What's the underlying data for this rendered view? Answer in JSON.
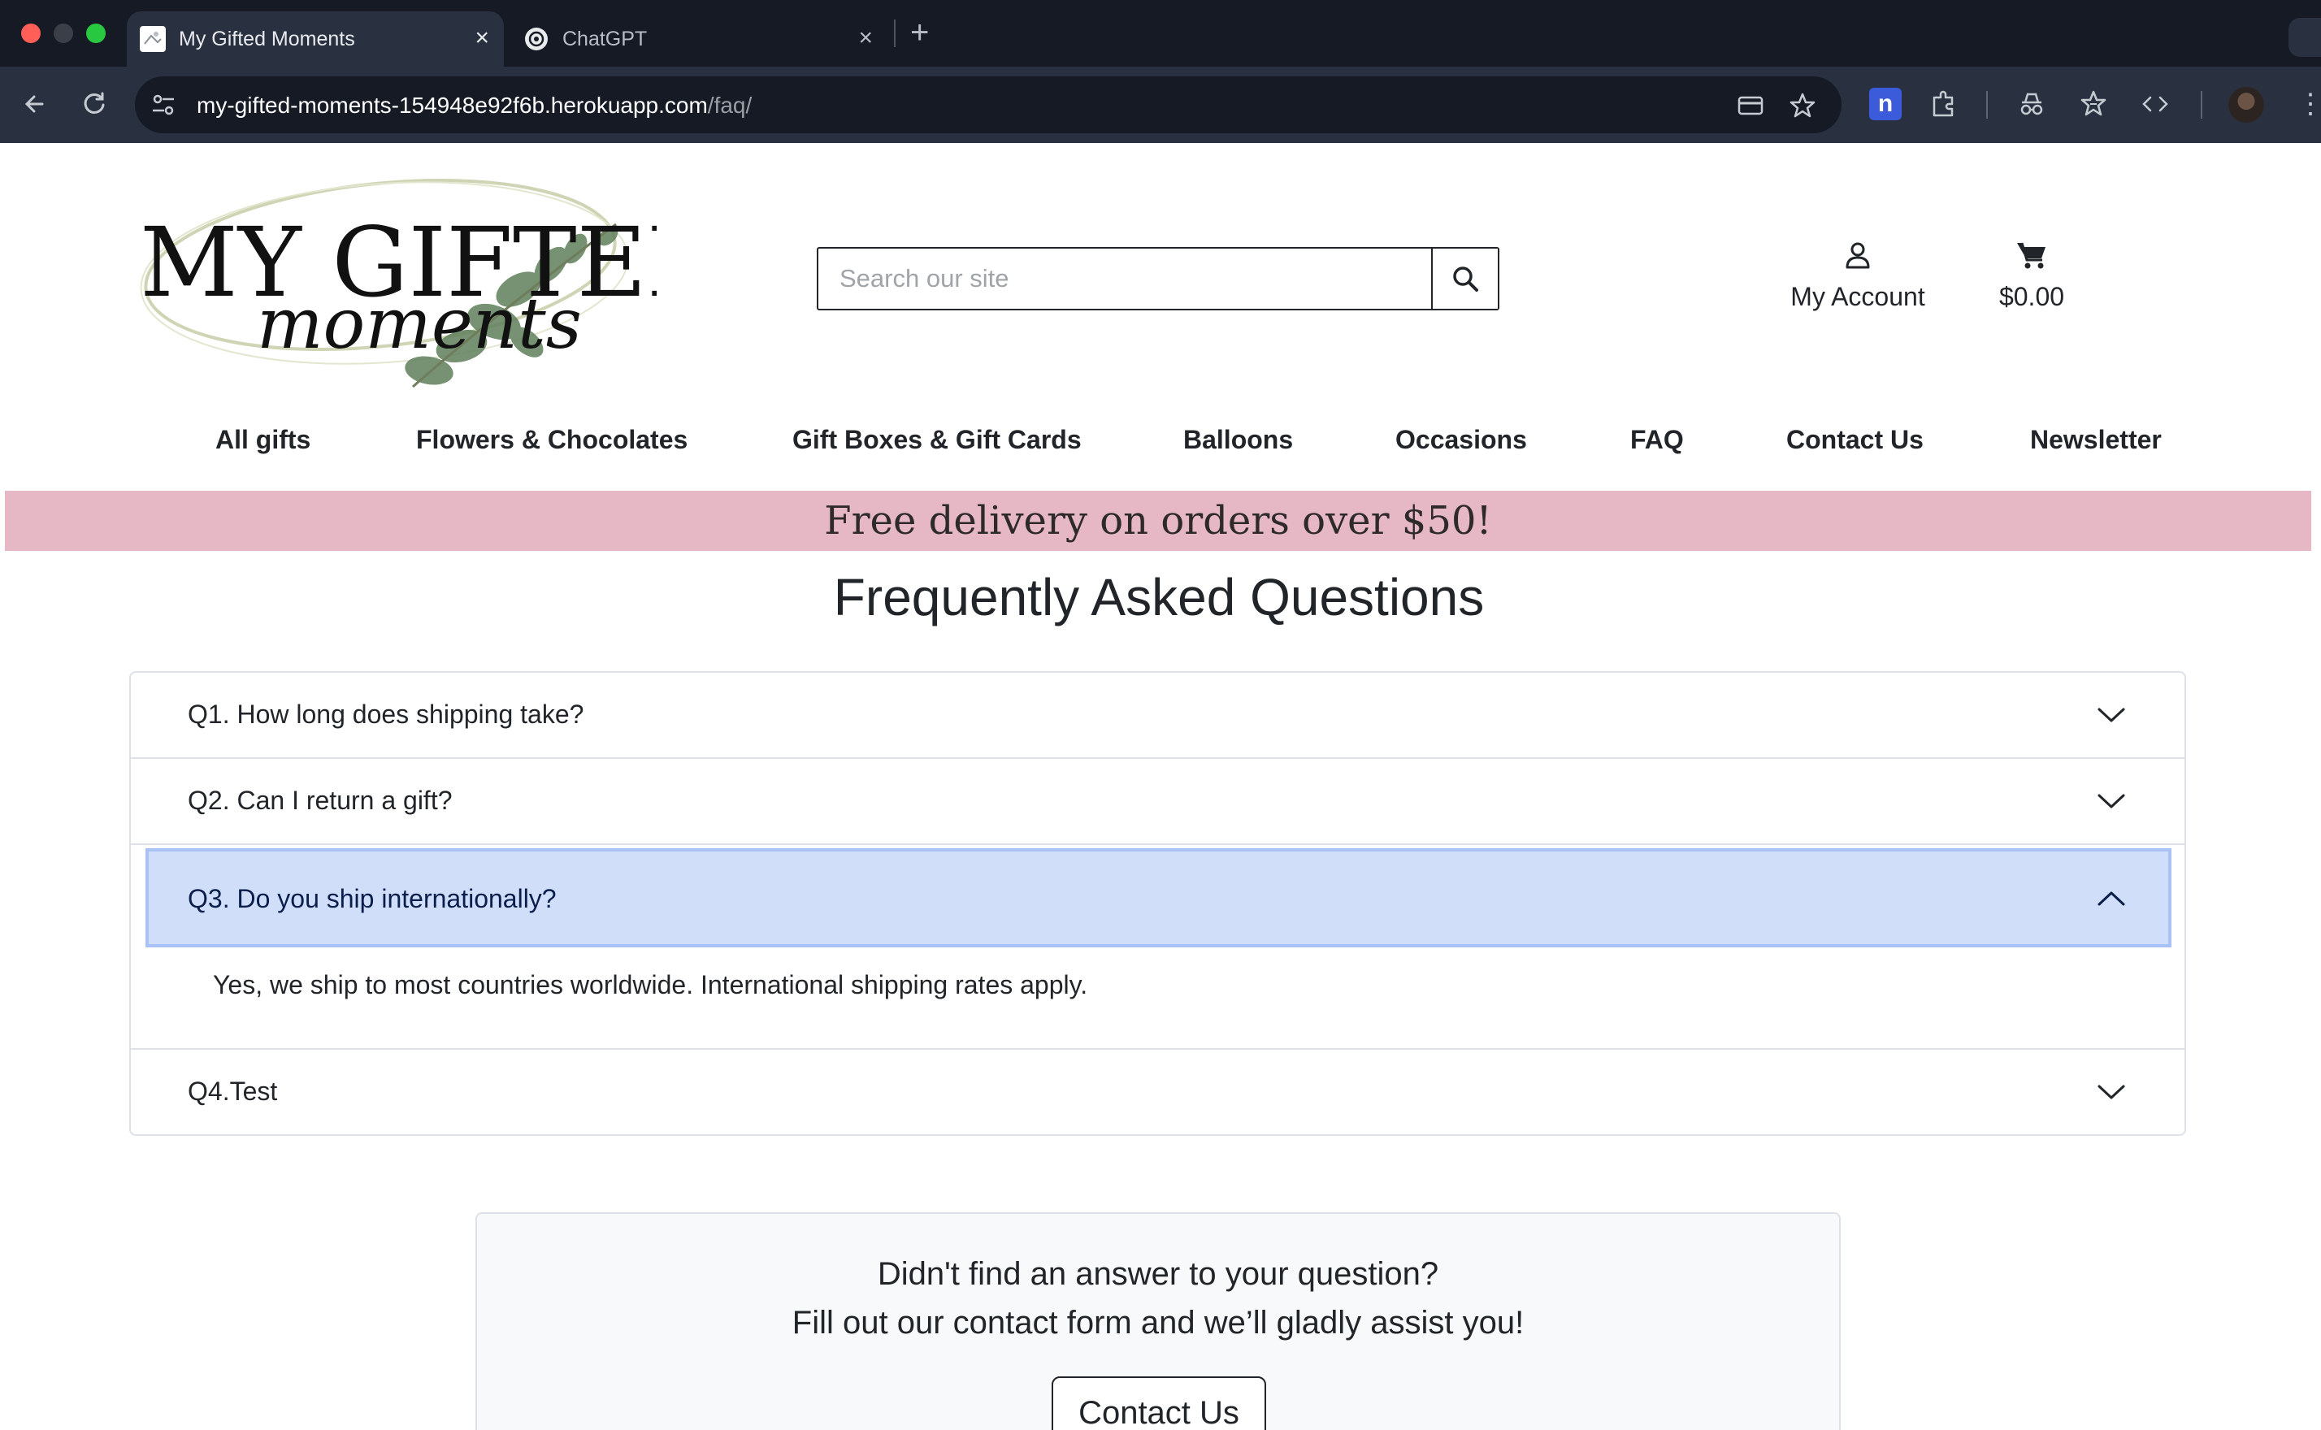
{
  "browser": {
    "tabs": [
      {
        "title": "My Gifted Moments",
        "active": true,
        "close": "×"
      },
      {
        "title": "ChatGPT",
        "active": false,
        "close": "×"
      }
    ],
    "new_tab": "+",
    "url_host": "my-gifted-moments-154948e92f6b.herokuapp.com",
    "url_path": "/faq/"
  },
  "header": {
    "logo_text_line1": "MY GIFTED",
    "logo_text_line2": "moments",
    "search_placeholder": "Search our site",
    "account_label": "My Account",
    "cart_total": "$0.00"
  },
  "nav": [
    "All gifts",
    "Flowers & Chocolates",
    "Gift Boxes & Gift Cards",
    "Balloons",
    "Occasions",
    "FAQ",
    "Contact Us",
    "Newsletter"
  ],
  "promo": "Free delivery on orders over $50!",
  "faq": {
    "title": "Frequently Asked Questions",
    "items": [
      {
        "question": "Q1. How long does shipping take?",
        "open": false
      },
      {
        "question": "Q2. Can I return a gift?",
        "open": false
      },
      {
        "question": "Q3. Do you ship internationally?",
        "open": true,
        "answer": "Yes, we ship to most countries worldwide. International shipping rates apply."
      },
      {
        "question": "Q4.Test",
        "open": false
      }
    ]
  },
  "contact_card": {
    "line1": "Didn't find an answer to your question?",
    "line2": "Fill out our contact form and we’ll gladly assist you!",
    "button": "Contact Us"
  },
  "colors": {
    "promo_bg": "#e6b8c6",
    "accordion_active_bg": "#d0defa",
    "chrome_dark": "#151a24",
    "chrome_toolbar": "#293140"
  }
}
